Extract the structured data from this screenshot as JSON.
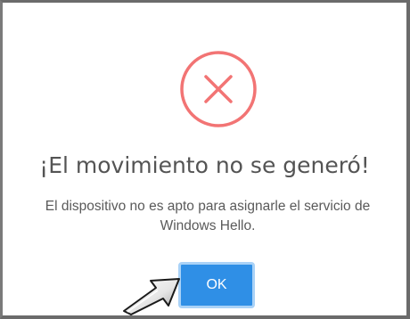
{
  "dialog": {
    "icon": "error-x-circle-icon",
    "title": "¡El movimiento no se generó!",
    "message": "El dispositivo no es apto para asignarle el servicio de Windows Hello.",
    "ok_label": "OK"
  },
  "colors": {
    "icon_stroke": "#f27474",
    "button_background": "#2f8fe6",
    "button_focus_ring": "#a9d2f7",
    "title_text": "#545454"
  },
  "annotation": {
    "icon": "pointer-arrow-icon"
  }
}
